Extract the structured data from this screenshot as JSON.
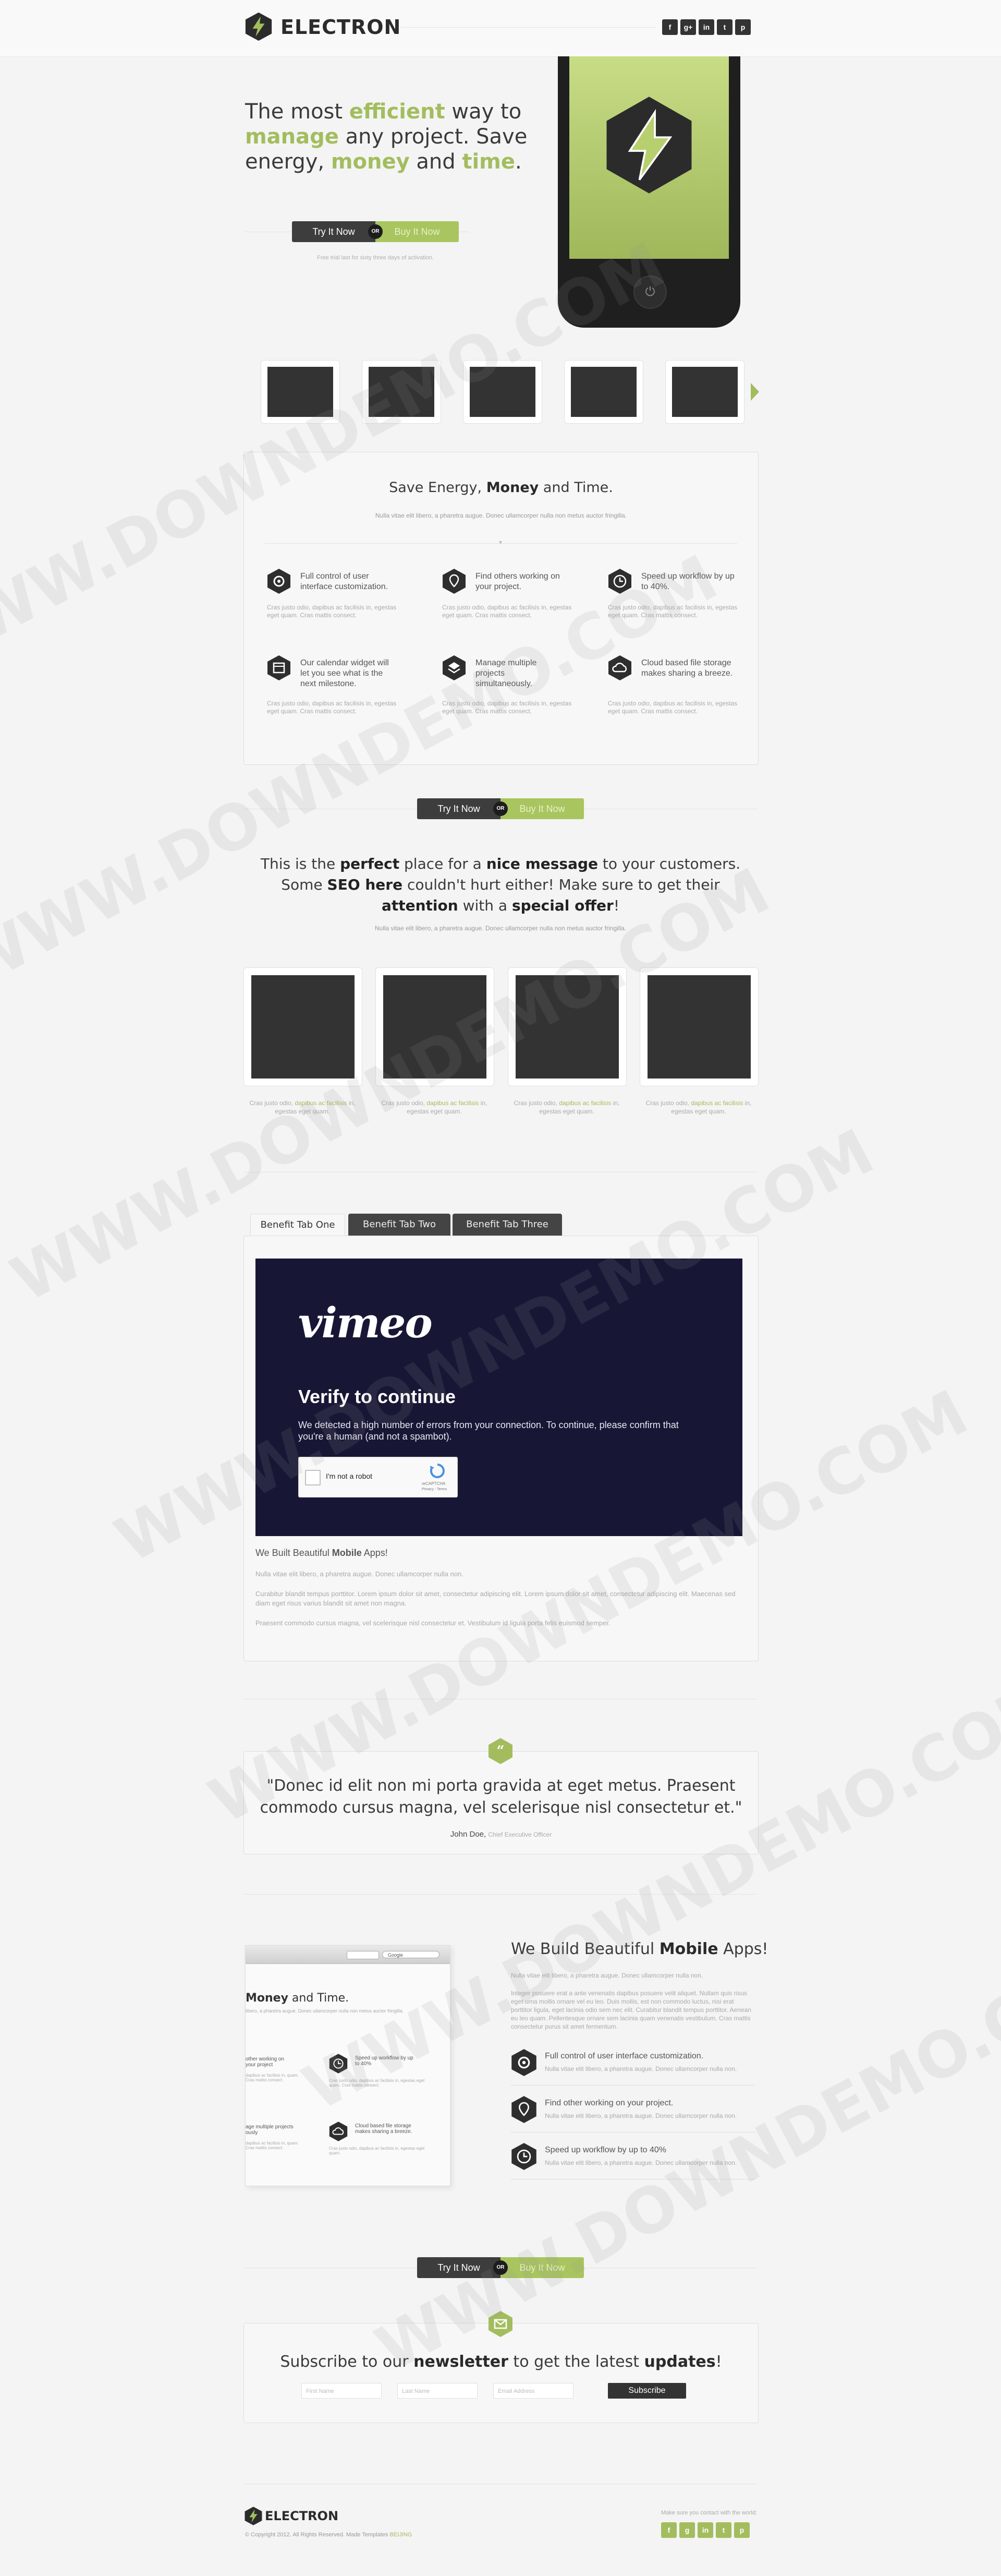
{
  "header": {
    "brand": "ELECTRON",
    "social": [
      "f",
      "g+",
      "in",
      "t",
      "p"
    ]
  },
  "hero": {
    "line1_pre": "The most ",
    "line1_hl": "efficient",
    "line1_post": " way to",
    "line2_hl": "manage",
    "line2_post": " any project. Save",
    "line3_pre": "energy, ",
    "line3_hl1": "money",
    "line3_mid": " and ",
    "line3_hl2": "time",
    "line3_end": ".",
    "btn_try": "Try It Now",
    "btn_or": "OR",
    "btn_buy": "Buy It Now",
    "note": "Free trial last for sixty three days of activation."
  },
  "features": {
    "title_pre": "Save Energy, ",
    "title_b": "Money",
    "title_post": " and Time.",
    "subtitle": "Nulla vitae elit libero, a pharetra augue. Donec ullamcorper nulla non metus auctor fringilla.",
    "items": [
      {
        "title": "Full control of user interface customization.",
        "body": "Cras justo odio, dapibus ac facilisis in, egestas eget quam. Cras mattis consect.",
        "icon": "gear-icon"
      },
      {
        "title": "Find others working on your project.",
        "body": "Cras justo odio, dapibus ac facilisis in, egestas eget quam. Cras mattis consect.",
        "icon": "location-pin-icon"
      },
      {
        "title": "Speed up workflow by up to 40%.",
        "body": "Cras justo odio, dapibus ac facilisis in, egestas eget quam. Cras mattis consect.",
        "icon": "clock-icon"
      },
      {
        "title": "Our calendar widget will let you see what is the next milestone.",
        "body": "Cras justo odio, dapibus ac facilisis in, egestas eget quam. Cras mattis consect.",
        "icon": "calendar-icon"
      },
      {
        "title": "Manage multiple projects simultaneously.",
        "body": "Cras justo odio, dapibus ac facilisis in, egestas eget quam. Cras mattis consect.",
        "icon": "layers-icon"
      },
      {
        "title": "Cloud based file storage makes sharing a breeze.",
        "body": "Cras justo odio, dapibus ac facilisis in, egestas eget quam. Cras mattis consect.",
        "icon": "cloud-icon"
      }
    ]
  },
  "cta": {
    "try": "Try It Now",
    "or": "OR",
    "buy": "Buy It Now"
  },
  "message": {
    "p1": "This is the ",
    "b1": "perfect",
    "p2": " place for a ",
    "b2": "nice message",
    "p3": " to your customers. Some ",
    "b3": "SEO here",
    "p4": " couldn't hurt either! Make sure to get their ",
    "b4": "attention",
    "p5": " with a ",
    "b5": "special offer",
    "p6": "!",
    "sub": "Nulla vitae elit libero, a pharetra augue. Donec ullamcorper nulla non metus auctor fringilla."
  },
  "gallery": {
    "captions": [
      {
        "a": "Cras justo odio, ",
        "g": "dapibus ac facilisis",
        "b": " in, egestas eget quam."
      },
      {
        "a": "Cras justo odio, ",
        "g": "dapibus ac facilisis",
        "b": " in, egestas eget quam."
      },
      {
        "a": "Cras justo odio, ",
        "g": "dapibus ac facilisis",
        "b": " in, egestas eget quam."
      },
      {
        "a": "Cras justo odio, ",
        "g": "dapibus ac facilisis",
        "b": " in, egestas eget quam."
      }
    ]
  },
  "tabs": {
    "labels": [
      "Benefit Tab One",
      "Benefit Tab Two",
      "Benefit Tab Three"
    ],
    "video": {
      "logo": "vimeo",
      "title": "Verify to continue",
      "desc": "We detected a high number of errors from your connection. To continue, please confirm that you're a human (and not a spambot).",
      "captcha_label": "I'm not a robot",
      "captcha_brand": "reCAPTCHA",
      "captcha_links": "Privacy - Terms"
    },
    "heading_pre": "We Built Beautiful ",
    "heading_b": "Mobile",
    "heading_post": " Apps!",
    "p1": "Nulla vitae elit libero, a pharetra augue. Donec ullamcorper nulla non.",
    "p2": "Curabitur blandit tempus porttitor. Lorem ipsum dolor sit amet, consectetur adipiscing elit. Lorem ipsum dolor sit amet, consectetur adipiscing elit. Maecenas sed diam eget risus varius blandit sit amet non magna.",
    "p3": "Praesent commodo cursus magna, vel scelerisque nisl consectetur et. Vestibulum id ligula porta felis euismod semper."
  },
  "testimonial": {
    "quote": "\"Donec id elit non mi porta gravida at eget metus. Praesent commodo cursus magna, vel scelerisque nisl consectetur et.\"",
    "author": "John Doe,",
    "role": "Chief Executive Officer"
  },
  "apps": {
    "mock_title_b": "Money",
    "mock_title_post": " and Time.",
    "mock_sub": "libero, a pharetra augue. Donec ullamcorper nulla non metus auctor fringilla.",
    "mock_search": "Google",
    "mock_items": [
      {
        "t": "other working on your project",
        "b": "dapibus ac facilisis in, quam. Cras mattis consect."
      },
      {
        "t": "Speed up workflow by up to 40%",
        "b": "Cras justo odio, dapibus ac facilisis in, egestas eget quam. Cras mattis consect."
      },
      {
        "t": "age multiple projects ously",
        "b": "dapibus ac facilisis in, quam. Cras mattis consect."
      },
      {
        "t": "Cloud based file storage makes sharing a breeze.",
        "b": "Cras justo odio, dapibus ac facilisis in, egestas eget quam."
      }
    ],
    "title_pre": "We Build Beautiful ",
    "title_b": "Mobile",
    "title_post": " Apps!",
    "p1": "Nulla vitae elit libero, a pharetra augue. Donec ullamcorper nulla non.",
    "p2": "Integer posuere erat a ante venenatis dapibus posuere velit aliquet. Nullam quis risus eget urna mollis ornare vel eu leo. Duis mollis, est non commodo luctus, nisi erat porttitor ligula, eget lacinia odio sem nec elit. Curabitur blandit tempus porttitor. Aenean eu leo quam. Pellentesque ornare sem lacinia quam venenatis vestibulum. Cras mattis consectetur purus sit amet fermentum.",
    "features": [
      {
        "title": "Full control of user interface customization.",
        "body": "Nulla vitae elit libero, a pharetra augue. Donec ullamcorper nulla non.",
        "icon": "gear-icon"
      },
      {
        "title": "Find other working on your project.",
        "body": "Nulla vitae elit libero, a pharetra augue. Donec ullamcorper nulla non.",
        "icon": "location-pin-icon"
      },
      {
        "title": "Speed up workflow by up to 40%",
        "body": "Nulla vitae elit libero, a pharetra augue. Donec ullamcorper nulla non.",
        "icon": "clock-icon"
      }
    ]
  },
  "newsletter": {
    "pre": "Subscribe to our ",
    "b1": "newsletter",
    "mid": " to get the latest ",
    "b2": "updates",
    "end": "!",
    "first": "First Name",
    "last": "Last Name",
    "email": "Email Address",
    "button": "Subscribe"
  },
  "footer": {
    "brand": "ELECTRON",
    "copy": "© Copyright 2012. All Rights Reserved. Made Templates ",
    "copy_link": "BEIJING",
    "note": "Make sure you contact with the world:",
    "social": [
      "f",
      "g",
      "in",
      "t",
      "p"
    ]
  },
  "watermark": "WWW.DOWNDEMO.COM",
  "colors": {
    "accent": "#a3bd5e",
    "dark": "#333333",
    "video_bg": "#171735"
  }
}
